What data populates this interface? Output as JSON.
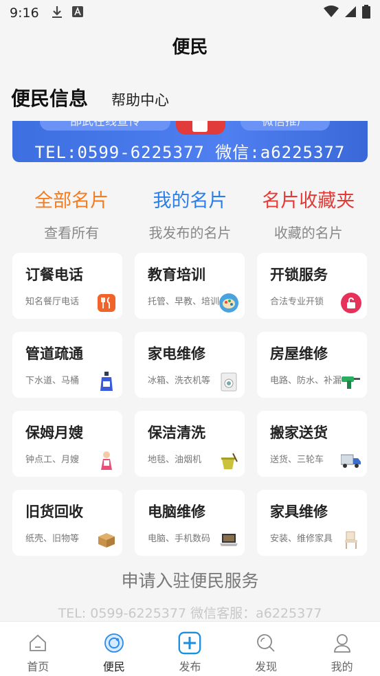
{
  "status": {
    "time": "9:16"
  },
  "header": {
    "title": "便民"
  },
  "tabs": {
    "main": "便民信息",
    "help": "帮助中心"
  },
  "banner": {
    "pill_left": "邵武在线宣传",
    "pill_right": "微信推广",
    "tel_line": "TEL:0599-6225377 微信:a6225377"
  },
  "categories": [
    {
      "title": "全部名片",
      "sub": "查看所有",
      "color": "#f57c1f"
    },
    {
      "title": "我的名片",
      "sub": "我发布的名片",
      "color": "#2b7de9"
    },
    {
      "title": "名片收藏夹",
      "sub": "收藏的名片",
      "color": "#e53935"
    }
  ],
  "services": [
    {
      "title": "订餐电话",
      "sub": "知名餐厅电话",
      "icon": "restaurant-icon"
    },
    {
      "title": "教育培训",
      "sub": "托管、早教、培训",
      "icon": "palette-icon"
    },
    {
      "title": "开锁服务",
      "sub": "合法专业开锁",
      "icon": "lock-icon"
    },
    {
      "title": "管道疏通",
      "sub": "下水道、马桶",
      "icon": "cleaner-bottle-icon"
    },
    {
      "title": "家电维修",
      "sub": "冰箱、洗衣机等",
      "icon": "washing-machine-icon"
    },
    {
      "title": "房屋维修",
      "sub": "电路、防水、补漏",
      "icon": "drill-icon"
    },
    {
      "title": "保姆月嫂",
      "sub": "钟点工、月嫂",
      "icon": "nanny-icon"
    },
    {
      "title": "保洁清洗",
      "sub": "地毯、油烟机",
      "icon": "bucket-icon"
    },
    {
      "title": "搬家送货",
      "sub": "送货、三轮车",
      "icon": "truck-icon"
    },
    {
      "title": "旧货回收",
      "sub": "纸壳、旧物等",
      "icon": "box-icon"
    },
    {
      "title": "电脑维修",
      "sub": "电脑、手机数码",
      "icon": "laptop-icon"
    },
    {
      "title": "家具维修",
      "sub": "安装、维修家具",
      "icon": "chair-icon"
    }
  ],
  "apply": "申请入驻便民服务",
  "contact": "TEL: 0599-6225377   微信客服：a6225377",
  "nav": [
    {
      "label": "首页",
      "icon": "home-icon"
    },
    {
      "label": "便民",
      "icon": "service-icon"
    },
    {
      "label": "发布",
      "icon": "publish-icon"
    },
    {
      "label": "发现",
      "icon": "discover-icon"
    },
    {
      "label": "我的",
      "icon": "profile-icon"
    }
  ]
}
